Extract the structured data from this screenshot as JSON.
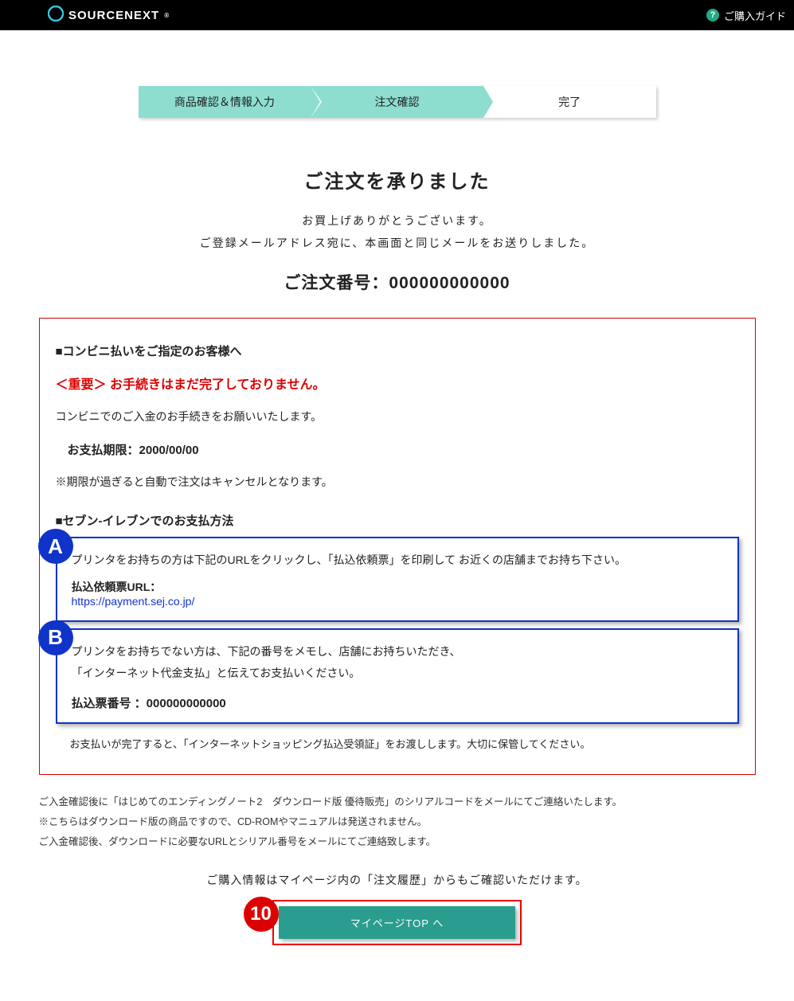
{
  "header": {
    "brand": "SOURCENEXT",
    "guide_label": "ご購入ガイド"
  },
  "progress": {
    "step1": "商品確認＆情報入力",
    "step2": "注文確認",
    "step3": "完了"
  },
  "title": "ご注文を承りました",
  "thanks_line1": "お買上げありがとうございます。",
  "thanks_line2": "ご登録メールアドレス宛に、本画面と同じメールをお送りしました。",
  "order_number_label": "ご注文番号：",
  "order_number": "000000000000",
  "notice": {
    "heading": "■コンビニ払いをご指定のお客様へ",
    "important": "＜重要＞ お手続きはまだ完了しておりません。",
    "body1": "コンビニでのご入金のお手続きをお願いいたします。",
    "deadline_label": "お支払期限：",
    "deadline_value": "2000/00/00",
    "body2": "※期限が過ぎると自動で注文はキャンセルとなります。",
    "payment_heading": "■セブン-イレブンでのお支払方法",
    "optionA": {
      "bullet": "A",
      "line1": "プリンタをお持ちの方は下記のURLをクリックし、「払込依頼票」を印刷して お近くの店舗までお持ち下さい。",
      "url_label": "払込依頼票URL：",
      "url": "https://payment.sej.co.jp/"
    },
    "optionB": {
      "bullet": "B",
      "line1": "プリンタをお持ちでない方は、下記の番号をメモし、店舗にお持ちいただき、",
      "line2": "「インターネット代金支払」と伝えてお支払いください。",
      "slip_label": "払込票番号 ：",
      "slip_number": "000000000000"
    },
    "after": "お支払いが完了すると、「インターネットショッピング払込受領証」をお渡しします。大切に保管してください。"
  },
  "footer_notes": {
    "n1": "ご入金確認後に「はじめてのエンディングノート2　ダウンロード版 優待販売」のシリアルコードをメールにてご連絡いたします。",
    "n2": "※こちらはダウンロード版の商品ですので、CD-ROMやマニュアルは発送されません。",
    "n3": "ご入金確認後、ダウンロードに必要なURLとシリアル番号をメールにてご連絡致します。"
  },
  "mypage_note": "ご購入情報はマイページ内の「注文履歴」からもご確認いただけます。",
  "button": {
    "bullet": "10",
    "label": "マイページTOP へ"
  }
}
